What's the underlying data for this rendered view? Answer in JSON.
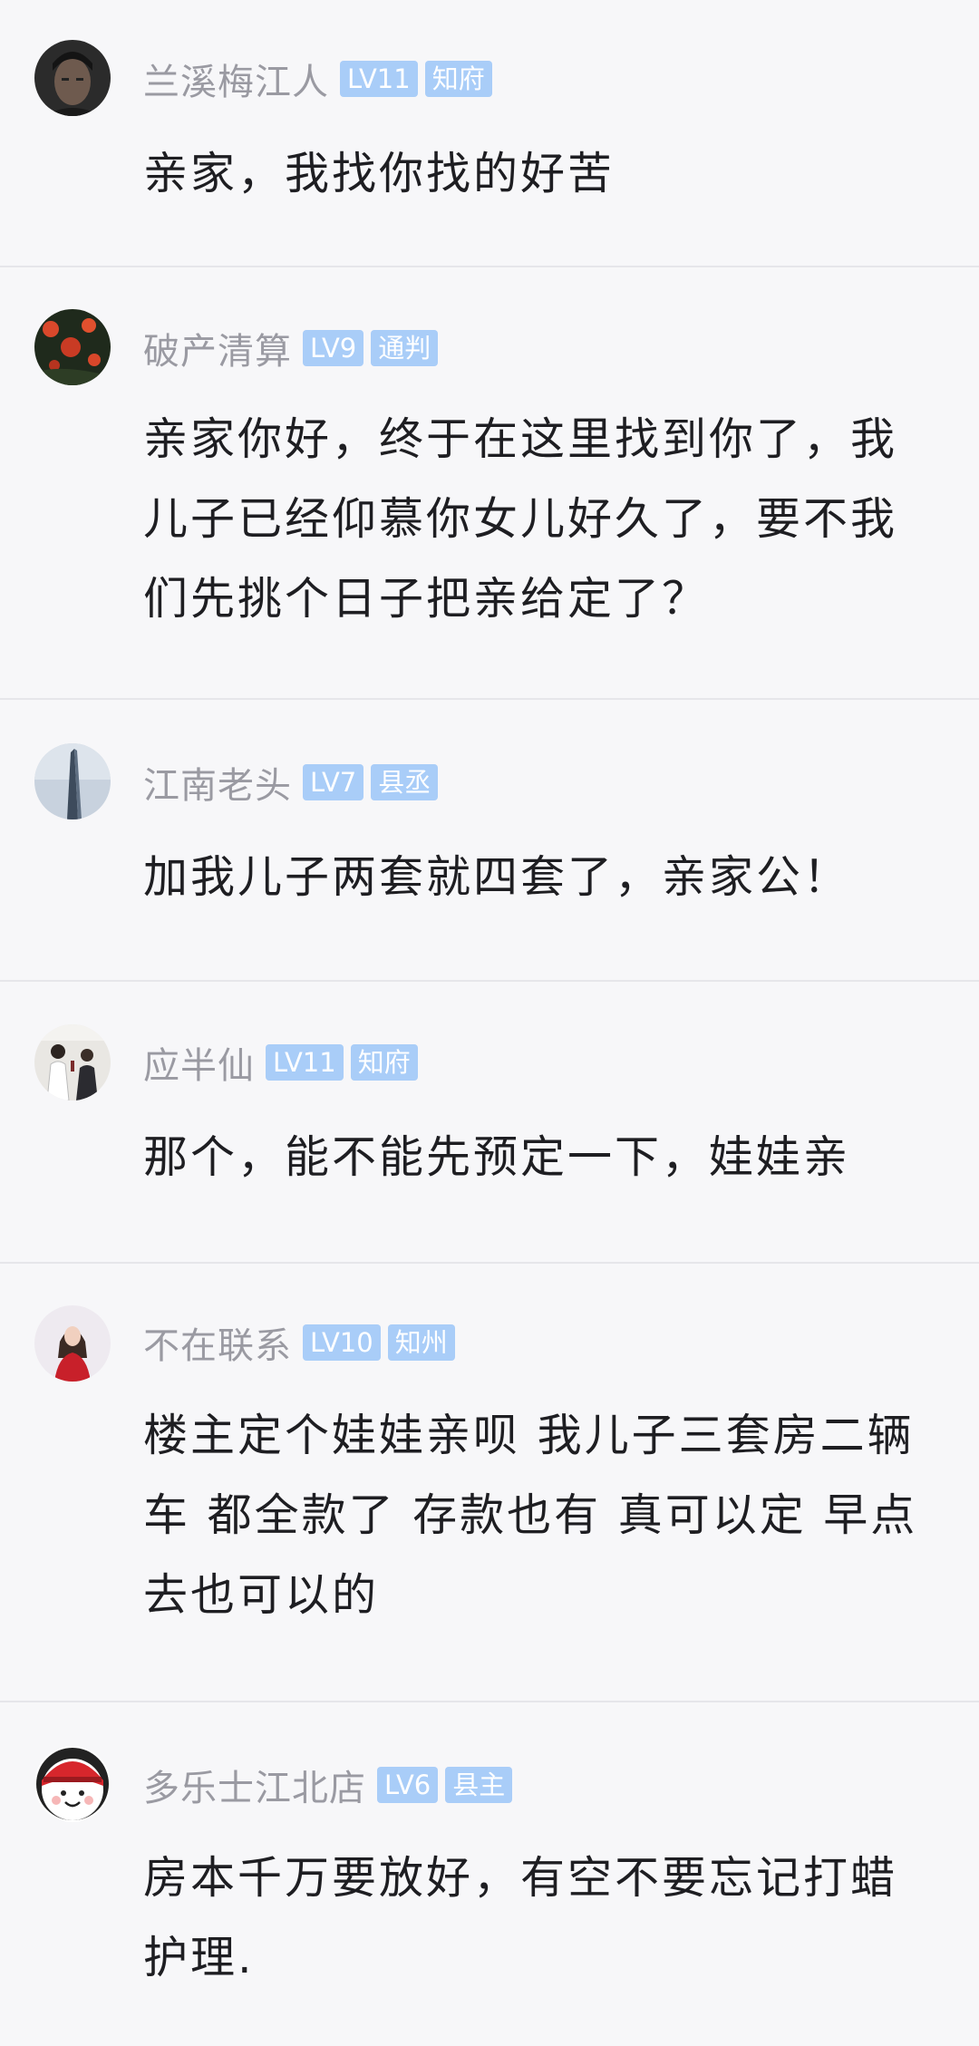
{
  "comments": [
    {
      "username": "兰溪梅江人",
      "level": "LV11",
      "title": "知府",
      "text": "亲家，我找你找的好苦",
      "avatar": "portrait-avatar"
    },
    {
      "username": "破产清算",
      "level": "LV9",
      "title": "通判",
      "text": "亲家你好，终于在这里找到你了，我儿子已经仰慕你女儿好久了，要不我们先挑个日子把亲给定了？",
      "avatar": "flowers-avatar"
    },
    {
      "username": "江南老头",
      "level": "LV7",
      "title": "县丞",
      "text": "加我儿子两套就四套了，亲家公！",
      "avatar": "skyscraper-avatar"
    },
    {
      "username": "应半仙",
      "level": "LV11",
      "title": "知府",
      "text": "那个，能不能先预定一下，娃娃亲",
      "avatar": "people-photo-avatar"
    },
    {
      "username": "不在联系",
      "level": "LV10",
      "title": "知州",
      "text": "楼主定个娃娃亲呗 我儿子三套房二辆车 都全款了 存款也有 真可以定 早点去也可以的",
      "avatar": "woman-red-dress-avatar"
    },
    {
      "username": "多乐士江北店",
      "level": "LV6",
      "title": "县主",
      "text": "房本千万要放好，有空不要忘记打蜡护理.",
      "avatar": "cartoon-face-avatar"
    }
  ]
}
